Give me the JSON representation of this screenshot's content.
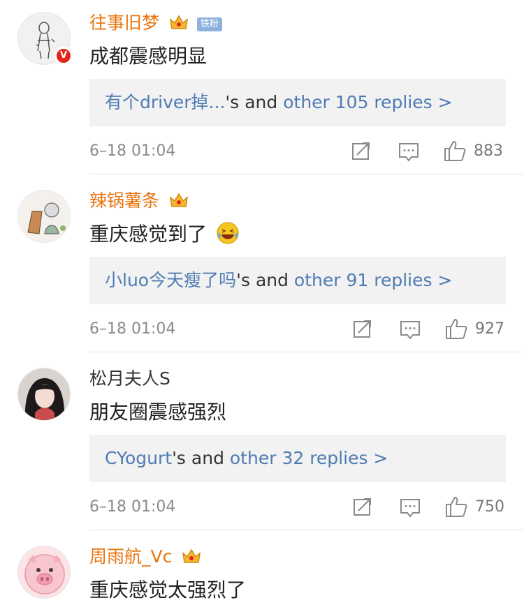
{
  "comments": [
    {
      "username": "往事旧梦",
      "fan_badge": "铁粉",
      "text": "成都震感明显",
      "reply_first": "有个driver掉...",
      "reply_mid": "'s and ",
      "reply_link": "other 105 replies >",
      "time": "6–18 01:04",
      "likes": "883"
    },
    {
      "username": "辣锅薯条",
      "text": "重庆感觉到了",
      "reply_first": "小luo今天瘦了吗",
      "reply_mid": "'s and ",
      "reply_link": "other 91 replies >",
      "time": "6–18 01:04",
      "likes": "927"
    },
    {
      "username": "松月夫人S",
      "text": "朋友圈震感强烈",
      "reply_first": "CYogurt",
      "reply_mid": "'s and ",
      "reply_link": "other 32 replies >",
      "time": "6–18 01:04",
      "likes": "750"
    },
    {
      "username": "周雨航_Vc",
      "text": "重庆感觉太强烈了"
    }
  ],
  "colors": {
    "vip_name": "#e8740e",
    "link": "#4f7bb3",
    "verified": "#e2231a",
    "reply_bg": "#f2f2f2"
  },
  "icons": [
    "crown-icon",
    "verified-icon",
    "share-icon",
    "comment-icon",
    "like-icon",
    "laughing-emoji-icon"
  ]
}
